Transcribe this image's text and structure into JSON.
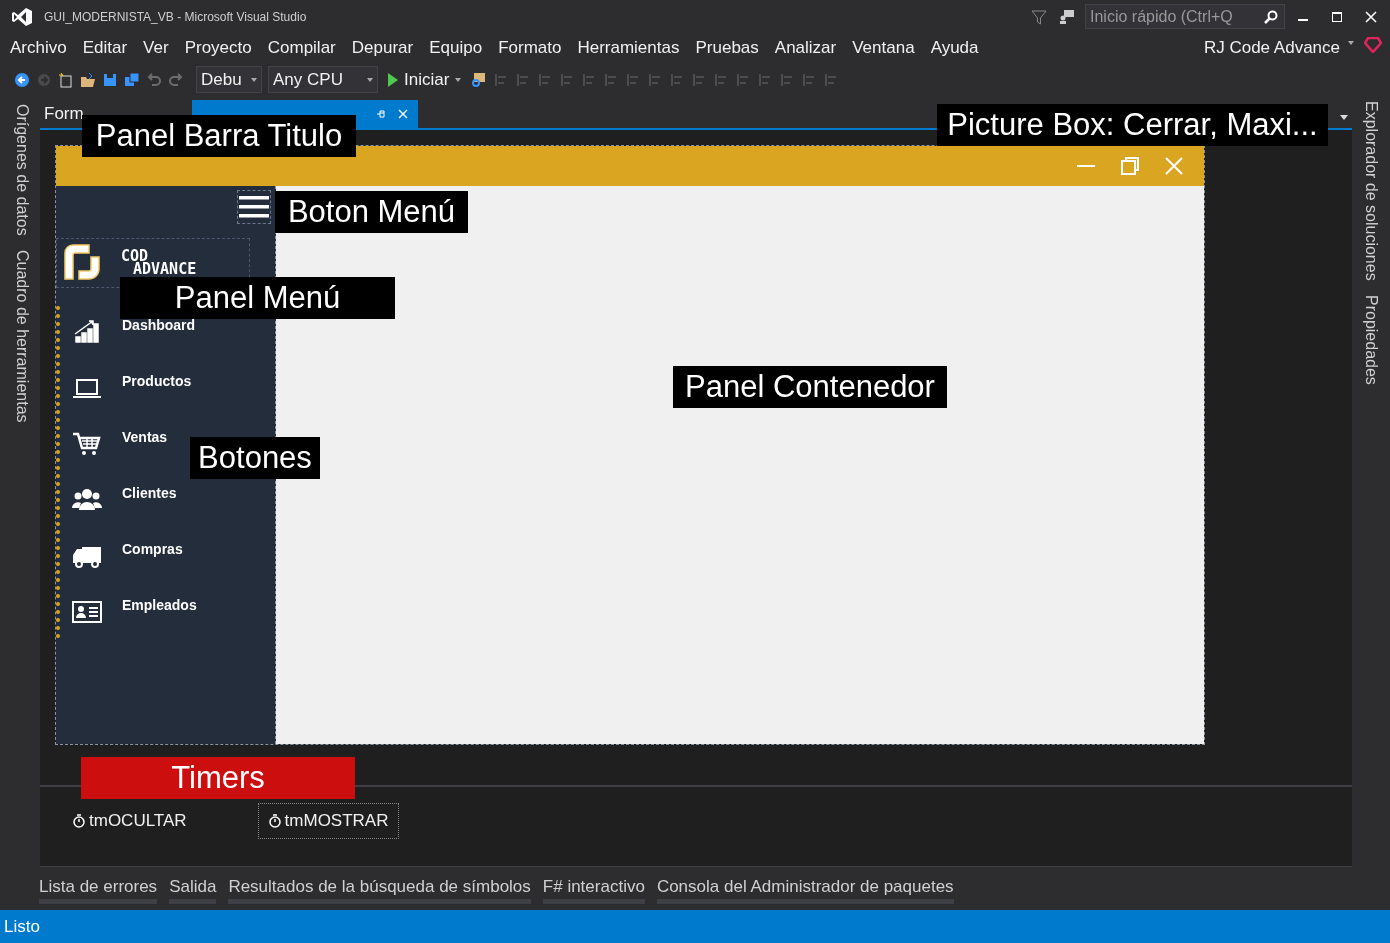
{
  "window": {
    "title": "GUI_MODERNISTA_VB - Microsoft Visual Studio"
  },
  "quick_launch": {
    "placeholder": "Inicio rápido (Ctrl+Q"
  },
  "menu": [
    "Archivo",
    "Editar",
    "Ver",
    "Proyecto",
    "Compilar",
    "Depurar",
    "Equipo",
    "Formato",
    "Herramientas",
    "Pruebas",
    "Analizar",
    "Ventana",
    "Ayuda"
  ],
  "account": "RJ Code Advance",
  "toolbar": {
    "configuration": "Debu",
    "platform": "Any CPU",
    "start": "Iniciar"
  },
  "left_panels": [
    "Orígenes de datos",
    "Cuadro de herramientas"
  ],
  "right_panels": [
    "Explorador de soluciones",
    "Propiedades"
  ],
  "document_tabs": [
    {
      "label": "Form",
      "selected": false
    },
    {
      "selected": true
    }
  ],
  "form": {
    "logo": [
      "COD",
      "ADVANCE"
    ],
    "menu_buttons": [
      {
        "kind": "chart",
        "label": "Dashboard"
      },
      {
        "kind": "laptop",
        "label": "Productos"
      },
      {
        "kind": "cart",
        "label": "Ventas"
      },
      {
        "kind": "people",
        "label": "Clientes"
      },
      {
        "kind": "truck",
        "label": "Compras"
      },
      {
        "kind": "idcard",
        "label": "Empleados"
      }
    ]
  },
  "annotations": [
    {
      "text": "Panel Barra Titulo",
      "color": "#000000"
    },
    {
      "text": "Picture Box: Cerrar, Maxi...",
      "color": "#000000"
    },
    {
      "text": "Boton Menú",
      "color": "#000000"
    },
    {
      "text": "Panel Menú",
      "color": "#000000"
    },
    {
      "text": "Panel Contenedor",
      "color": "#000000"
    },
    {
      "text": "Botones",
      "color": "#000000"
    },
    {
      "text": "Timers",
      "color": "#cc0e0e"
    }
  ],
  "timers": [
    {
      "label": "tmOCULTAR",
      "selected": false
    },
    {
      "label": "tmMOSTRAR",
      "selected": true
    }
  ],
  "bottom_tabs": [
    "Lista de errores",
    "Salida",
    "Resultados de la búsqueda de símbolos",
    "F# interactivo",
    "Consola del Administrador de paquetes"
  ],
  "status_bar": "Listo"
}
